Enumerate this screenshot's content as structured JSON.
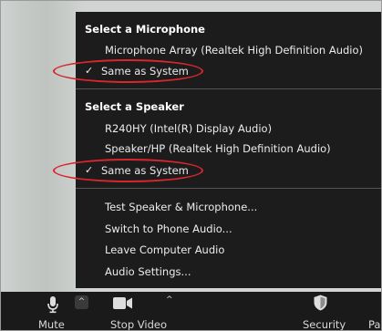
{
  "microphone_menu": {
    "header": "Select a Microphone",
    "items": [
      {
        "label": "Microphone Array (Realtek High Definition Audio)",
        "checked": false
      },
      {
        "label": "Same as System",
        "checked": true
      }
    ]
  },
  "speaker_menu": {
    "header": "Select a Speaker",
    "items": [
      {
        "label": "R240HY (Intel(R) Display Audio)",
        "checked": false
      },
      {
        "label": "Speaker/HP (Realtek High Definition Audio)",
        "checked": false
      },
      {
        "label": "Same as System",
        "checked": true
      }
    ]
  },
  "actions": [
    {
      "label": "Test Speaker & Microphone..."
    },
    {
      "label": "Switch to Phone Audio..."
    },
    {
      "label": "Leave Computer Audio"
    },
    {
      "label": "Audio Settings..."
    }
  ],
  "toolbar": {
    "mute_label": "Mute",
    "stop_video_label": "Stop Video",
    "security_label": "Security",
    "participants_label": "Pa"
  },
  "colors": {
    "highlight_circle": "#d8262d",
    "menu_background": "#1c1c1c",
    "toolbar_background": "#1a1a1a"
  }
}
